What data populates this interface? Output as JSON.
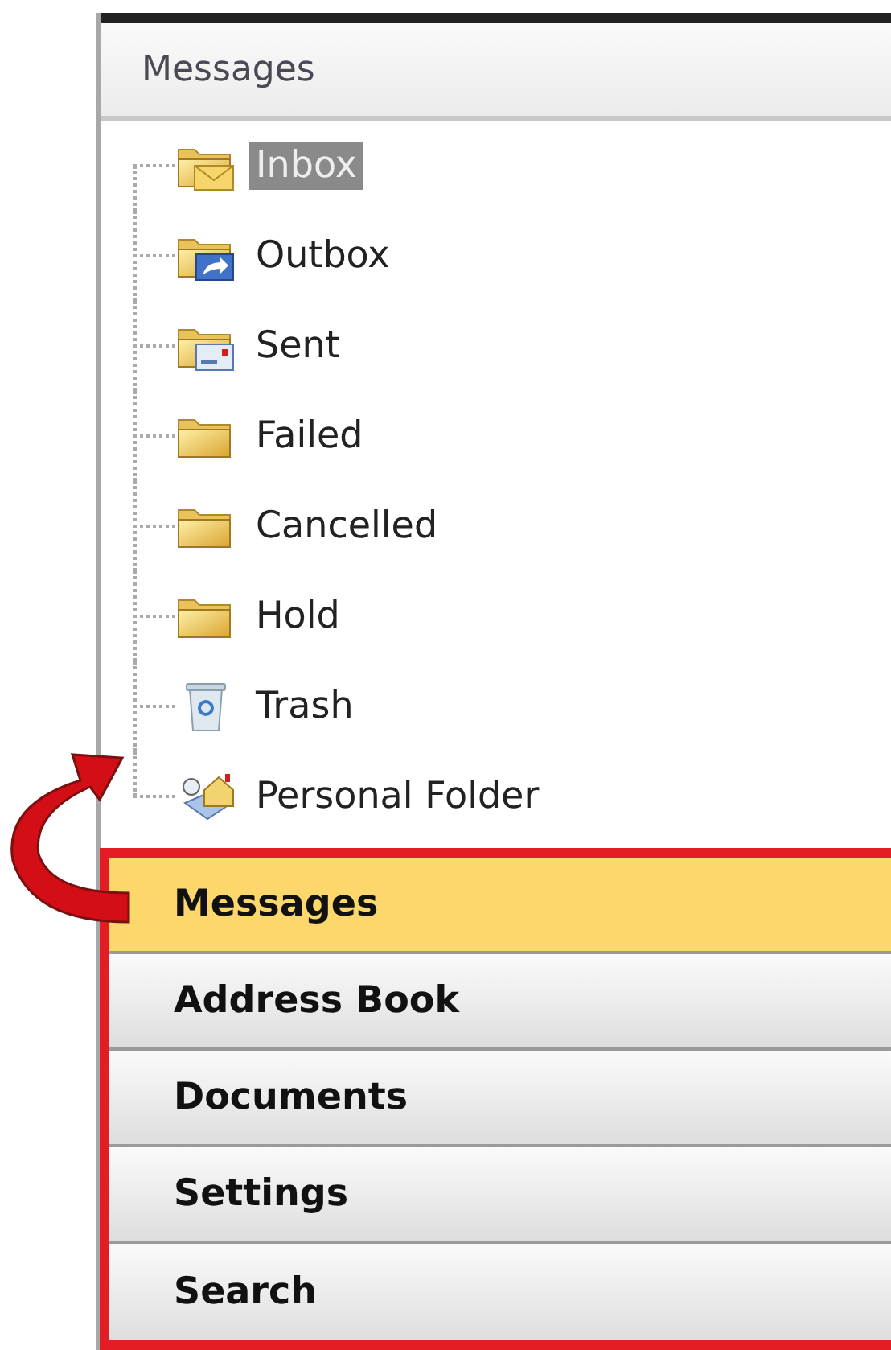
{
  "panel": {
    "title": "Messages"
  },
  "folders": [
    {
      "label": "Inbox",
      "kind": "inbox",
      "selected": true
    },
    {
      "label": "Outbox",
      "kind": "outbox",
      "selected": false
    },
    {
      "label": "Sent",
      "kind": "sent",
      "selected": false
    },
    {
      "label": "Failed",
      "kind": "folder",
      "selected": false
    },
    {
      "label": "Cancelled",
      "kind": "folder",
      "selected": false
    },
    {
      "label": "Hold",
      "kind": "folder",
      "selected": false
    },
    {
      "label": "Trash",
      "kind": "trash",
      "selected": false
    },
    {
      "label": "Personal Folder",
      "kind": "personal",
      "selected": false
    }
  ],
  "navigation": [
    {
      "label": "Messages",
      "selected": true
    },
    {
      "label": "Address Book",
      "selected": false
    },
    {
      "label": "Documents",
      "selected": false
    },
    {
      "label": "Settings",
      "selected": false
    },
    {
      "label": "Search",
      "selected": false
    }
  ]
}
